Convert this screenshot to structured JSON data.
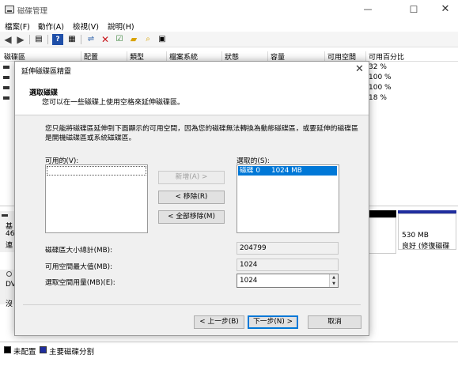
{
  "window": {
    "title": "磁碟管理",
    "controls": {
      "minimize": "—",
      "maximize": "☐",
      "close": "✕"
    }
  },
  "menu": [
    "檔案(F)",
    "動作(A)",
    "檢視(V)",
    "說明(H)"
  ],
  "toolbar_icons": [
    "back-arrow-icon",
    "forward-arrow-icon",
    "list-icon",
    "help-icon",
    "properties-icon",
    "connect-icon",
    "delete-icon",
    "check-icon",
    "folder-icon",
    "search-icon",
    "grid-icon"
  ],
  "columns": [
    "磁碟區",
    "配置",
    "類型",
    "檔案系統",
    "狀態",
    "容量",
    "可用空間",
    "可用百分比"
  ],
  "volumes": [
    {
      "pct": "32 %"
    },
    {
      "pct": "100 %"
    },
    {
      "pct": "100 %"
    },
    {
      "pct": "18 %"
    }
  ],
  "lower": {
    "disk_left_labels": [
      "基",
      "46",
      "連",
      "DV",
      "沒"
    ],
    "right_partition": {
      "size": "530 MB",
      "status": "良好 (修復磁碟"
    }
  },
  "legend": [
    {
      "label": "未配置",
      "color": "#000000"
    },
    {
      "label": "主要磁碟分割",
      "color": "#1f2d9e"
    }
  ],
  "dialog": {
    "title": "延伸磁碟區精靈",
    "close": "✕",
    "heading": "選取磁碟",
    "subheading": "您可以在一些磁碟上使用空格來延伸磁碟區。",
    "description": "您只能將磁碟區延伸到下面顯示的可用空間，因為您的磁碟無法轉換為動態磁碟區，或要延伸的磁碟區是開機磁碟區或系統磁碟區。",
    "available_label": "可用的(V):",
    "selected_label": "選取的(S):",
    "selected_items": [
      "磁碟 0     1024 MB"
    ],
    "buttons": {
      "add": "新增(A) >",
      "remove": "< 移除(R)",
      "remove_all": "< 全部移除(M)",
      "back": "< 上一步(B)",
      "next": "下一步(N) >",
      "cancel": "取消"
    },
    "fields": {
      "total_label": "磁碟區大小總計(MB):",
      "total_value": "204799",
      "max_label": "可用空間最大值(MB):",
      "max_value": "1024",
      "amount_label": "選取空間用量(MB)(E):",
      "amount_value": "1024"
    }
  }
}
